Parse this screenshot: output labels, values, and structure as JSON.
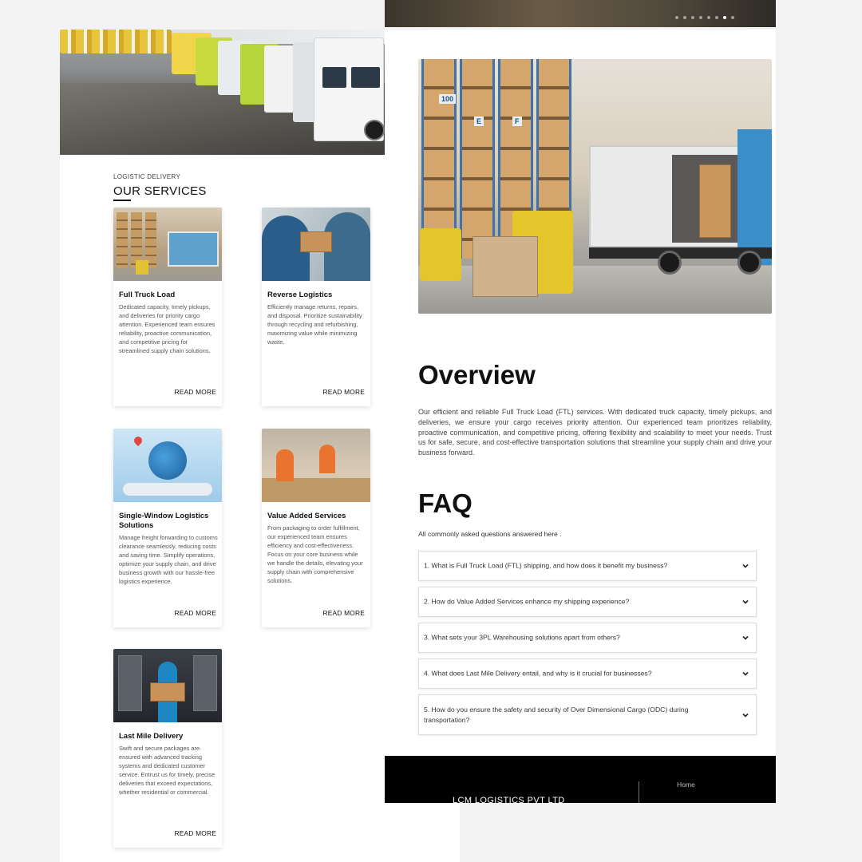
{
  "services": {
    "kicker": "LOGISTIC DELIVERY",
    "title": "OUR SERVICES",
    "read_more": "READ MORE",
    "cards": [
      {
        "title": "Full Truck Load",
        "desc": "Dedicated capacity, timely pickups, and deliveries for priority cargo attention. Experienced team ensures reliability, proactive communication, and competitive pricing for streamlined supply chain solutions."
      },
      {
        "title": "Reverse Logistics",
        "desc": "Efficiently manage returns, repairs, and disposal. Prioritize sustainability through recycling and refurbishing, maximizing value while minimizing waste."
      },
      {
        "title": "Single-Window Logistics Solutions",
        "desc": "Manage freight forwarding to customs clearance seamlessly, reducing costs and saving time. Simplify operations, optimize your supply chain, and drive business growth with our hassle-free logistics experience."
      },
      {
        "title": "Value Added Services",
        "desc": "From packaging to order fulfillment, our experienced team ensures efficiency and cost-effectiveness. Focus on your core business while we handle the details, elevating your supply chain with comprehensive solutions."
      },
      {
        "title": "Last Mile Delivery",
        "desc": "Swift and secure packages are ensured with advanced tracking systems and dedicated customer service. Entrust us for timely, precise deliveries that exceed expectations, whether residential or commercial."
      }
    ]
  },
  "carousel": {
    "slides": 8,
    "active_index": 6
  },
  "overview": {
    "title": "Overview",
    "text": "Our efficient and reliable Full Truck Load (FTL) services. With dedicated truck capacity, timely pickups, and deliveries, we ensure your cargo receives priority attention. Our experienced team prioritizes reliability, proactive communication, and competitive pricing, offering flexibility and scalability to meet your needs. Trust us for safe, secure, and cost-effective transportation solutions that streamline your supply chain and drive your business forward."
  },
  "photo_labels": {
    "rack_a": "100",
    "rack_b": "E",
    "rack_c": "F"
  },
  "faq": {
    "title": "FAQ",
    "subtitle": "All commonly asked questions answered here .",
    "items": [
      "1. What is Full Truck Load (FTL) shipping, and how does it benefit my business?",
      "2. How do Value Added Services enhance my shipping experience?",
      "3. What sets your 3PL Warehousing solutions apart from others?",
      "4. What does Last Mile Delivery entail, and why is it crucial for businesses?",
      "5. How do you ensure the safety and security of Over Dimensional Cargo (ODC) during transportation?"
    ]
  },
  "footer": {
    "company": "LCM LOGISTICS PVT LTD",
    "links": [
      "Home"
    ]
  },
  "colors": {
    "page_bg": "#f3f3f3",
    "footer_bg": "#000000",
    "text_dark": "#111111"
  },
  "icons": {
    "faq_toggle": "chevron-down-icon"
  }
}
